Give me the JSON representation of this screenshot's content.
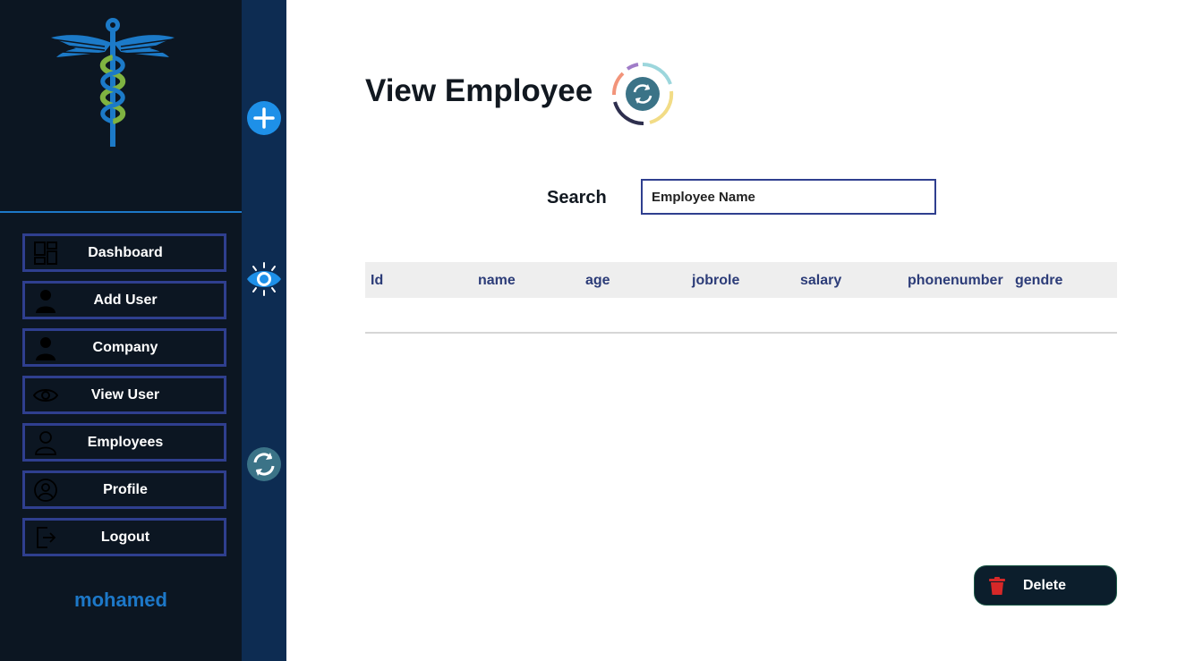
{
  "sidebar": {
    "logo_icon": "caduceus-icon",
    "items": [
      {
        "label": "Dashboard",
        "icon": "dashboard-icon"
      },
      {
        "label": "Add User",
        "icon": "user-icon"
      },
      {
        "label": "Company",
        "icon": "user-icon"
      },
      {
        "label": "View User",
        "icon": "eye-icon"
      },
      {
        "label": "Employees",
        "icon": "user-outline-icon"
      },
      {
        "label": "Profile",
        "icon": "profile-circle-icon"
      },
      {
        "label": "Logout",
        "icon": "logout-icon"
      }
    ],
    "username": "mohamed"
  },
  "rail": {
    "icons": [
      "plus-circle-icon",
      "eye-icon",
      "refresh-circle-icon"
    ]
  },
  "main": {
    "title": "View Employee",
    "title_icon": "refresh-ring-icon",
    "search": {
      "label": "Search",
      "value": "",
      "placeholder": "Employee Name"
    },
    "table": {
      "columns": [
        "Id",
        "name",
        "age",
        "jobrole",
        "salary",
        "phonenumber",
        "gendre"
      ],
      "rows": []
    },
    "delete_button": {
      "label": "Delete",
      "icon": "trash-icon"
    }
  },
  "colors": {
    "sidebar_bg": "#0c1622",
    "rail_bg": "#0d2c52",
    "accent_blue": "#1d78c8",
    "border_navy": "#2f3f8f",
    "table_header_text": "#2c3c78",
    "delete_icon": "#d62828"
  }
}
